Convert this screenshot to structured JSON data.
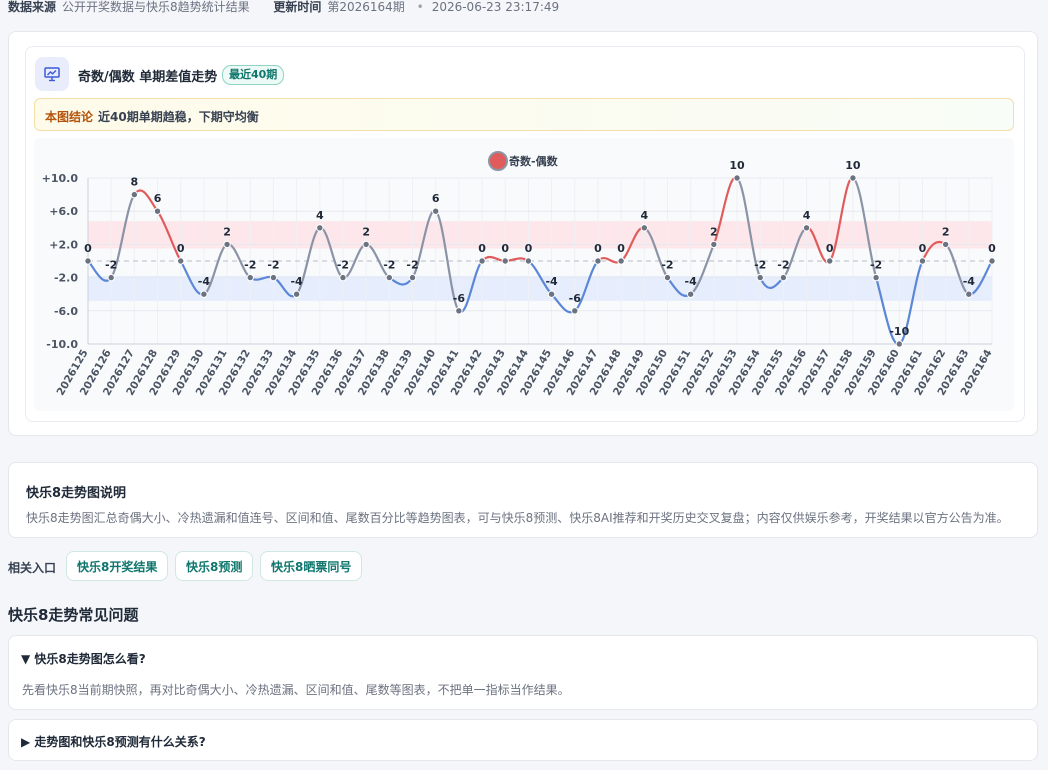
{
  "header": {
    "source_label": "数据来源",
    "source_value": "公开开奖数据与快乐8趋势统计结果",
    "update_label": "更新时间",
    "update_value": "第2026164期",
    "update_sep": "•",
    "update_time": "2026-06-23 23:17:49"
  },
  "chart_card": {
    "title": "奇数/偶数 单期差值走势",
    "badge": "最近40期",
    "conclusion_tag": "本图结论",
    "conclusion_text": "近40期单期趋稳，下期守均衡"
  },
  "colors": {
    "positive": "#e05c5c",
    "negative": "#5b87d6",
    "neutral": "#8a94a6",
    "upper_band": "#fde7ea",
    "lower_band": "#e6edfd",
    "accent": "#0f766e"
  },
  "chart_data": {
    "type": "line",
    "title": "",
    "xlabel": "",
    "ylabel": "",
    "ylim": [
      -10,
      10
    ],
    "yticks": [
      "+10.0",
      "+6.0",
      "+2.0",
      "-2.0",
      "-6.0",
      "-10.0"
    ],
    "yticks_values": [
      10,
      6,
      2,
      -2,
      -6,
      -10
    ],
    "reference_line": 0,
    "upper_band": [
      1.5,
      4.8
    ],
    "lower_band": [
      -1.8,
      -4.8
    ],
    "legend_position": "top-center",
    "grid": true,
    "x": [
      "2026125",
      "2026126",
      "2026127",
      "2026128",
      "2026129",
      "2026130",
      "2026131",
      "2026132",
      "2026133",
      "2026134",
      "2026135",
      "2026136",
      "2026137",
      "2026138",
      "2026139",
      "2026140",
      "2026141",
      "2026142",
      "2026143",
      "2026144",
      "2026145",
      "2026146",
      "2026147",
      "2026148",
      "2026149",
      "2026150",
      "2026151",
      "2026152",
      "2026153",
      "2026154",
      "2026155",
      "2026156",
      "2026157",
      "2026158",
      "2026159",
      "2026160",
      "2026161",
      "2026162",
      "2026163",
      "2026164"
    ],
    "series": [
      {
        "name": "奇数-偶数",
        "values": [
          0,
          -2,
          8,
          6,
          0,
          -4,
          2,
          -2,
          -2,
          -4,
          4,
          -2,
          2,
          -2,
          -2,
          6,
          -6,
          0,
          0,
          0,
          -4,
          -6,
          0,
          0,
          4,
          -2,
          -4,
          2,
          10,
          -2,
          -2,
          4,
          0,
          10,
          -2,
          -10,
          0,
          2,
          -4,
          0
        ],
        "labels": [
          "0",
          "-2",
          "8",
          "6",
          "0",
          "-4",
          "2",
          "-2",
          "-2",
          "-4",
          "4",
          "-2",
          "2",
          "-2",
          "-2",
          "6",
          "-6",
          "0",
          "0",
          "0",
          "-4",
          "-6",
          "0",
          "0",
          "4",
          "-2",
          "-4",
          "2",
          "10",
          "-2",
          "-2",
          "4",
          "0",
          "10",
          "-2",
          "-10",
          "0",
          "2",
          "-4",
          "0"
        ]
      }
    ]
  },
  "description": {
    "title": "快乐8走势图说明",
    "text": "快乐8走势图汇总奇偶大小、冷热遗漏和值连号、区间和值、尾数百分比等趋势图表，可与快乐8预测、快乐8AI推荐和开奖历史交叉复盘；内容仅供娱乐参考，开奖结果以官方公告为准。"
  },
  "related": {
    "label": "相关入口",
    "links": [
      "快乐8开奖结果",
      "快乐8预测",
      "快乐8晒票同号"
    ]
  },
  "faq": {
    "heading": "快乐8走势常见问题",
    "items": [
      {
        "marker": "▼",
        "question": "快乐8走势图怎么看?",
        "answer": "先看快乐8当前期快照，再对比奇偶大小、冷热遗漏、区间和值、尾数等图表，不把单一指标当作结果。"
      },
      {
        "marker": "▶",
        "question": "走势图和快乐8预测有什么关系?"
      }
    ]
  }
}
